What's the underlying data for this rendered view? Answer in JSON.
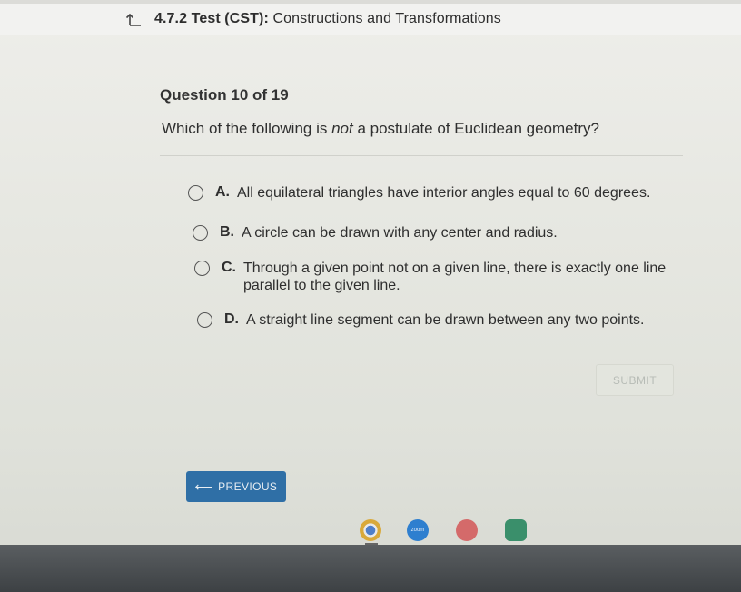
{
  "header": {
    "section": "4.7.2",
    "test_type": "Test (CST):",
    "title": "Constructions and Transformations"
  },
  "question": {
    "number_label": "Question 10 of 19",
    "text_before": "Which of the following is ",
    "text_emphasis": "not",
    "text_after": " a postulate of Euclidean geometry?"
  },
  "options": [
    {
      "letter": "A.",
      "text": "All equilateral triangles have interior angles equal to 60 degrees."
    },
    {
      "letter": "B.",
      "text": "A circle can be drawn with any center and radius."
    },
    {
      "letter": "C.",
      "text": "Through a given point not on a given line, there is exactly one line parallel to the given line."
    },
    {
      "letter": "D.",
      "text": "A straight line segment can be drawn between any two points."
    }
  ],
  "buttons": {
    "submit": "SUBMIT",
    "previous": "PREVIOUS",
    "previous_arrow": "⟵"
  },
  "taskbar": {
    "zoom_label": "zoom"
  }
}
